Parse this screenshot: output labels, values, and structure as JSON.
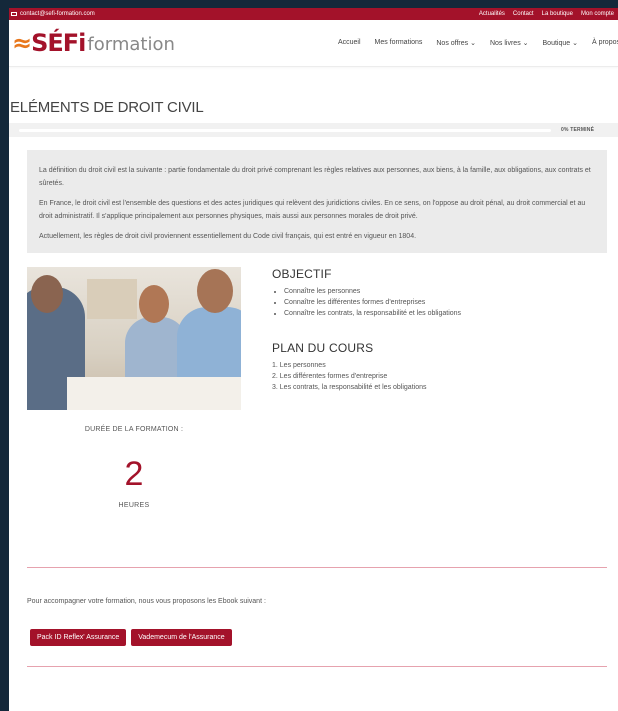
{
  "topbar": {
    "email": "contact@sefi-formation.com",
    "links": [
      "Actualités",
      "Contact",
      "La boutique",
      "Mon compte"
    ]
  },
  "brand": {
    "mark": "SÉFi",
    "word": "formation"
  },
  "nav": {
    "items": [
      {
        "label": "Accueil",
        "dropdown": false
      },
      {
        "label": "Mes formations",
        "dropdown": false
      },
      {
        "label": "Nos offres",
        "dropdown": true
      },
      {
        "label": "Nos livres",
        "dropdown": true
      },
      {
        "label": "Boutique",
        "dropdown": true
      },
      {
        "label": "À propos",
        "dropdown": false
      }
    ]
  },
  "course": {
    "title": "ELÉMENTS DE DROIT CIVIL",
    "progress_percent": 0,
    "progress_label": "0% TERMINÉ",
    "intro": [
      "La définition du droit civil est la suivante : partie fondamentale du droit privé comprenant les règles relatives aux personnes, aux biens, à la famille, aux obligations, aux contrats et sûretés.",
      "En France, le droit civil est l'ensemble des questions et des actes juridiques qui relèvent des juridictions civiles. En ce sens, on l'oppose au droit pénal, au droit commercial et au droit administratif. Il s'applique principalement aux personnes physiques, mais aussi aux personnes morales de droit privé.",
      "Actuellement, les règles de droit civil proviennent essentiellement du Code civil français, qui est entré en vigueur en 1804."
    ],
    "duration": {
      "label": "DURÉE DE LA FORMATION :",
      "value": "2",
      "unit": "HEURES"
    },
    "objectif": {
      "heading": "OBJECTIF",
      "items": [
        "Connaître les personnes",
        "Connaître les différentes formes d'entreprises",
        "Connaître les contrats, la responsabilité et les obligations"
      ]
    },
    "plan": {
      "heading": "PLAN DU COURS",
      "items": [
        "1. Les personnes",
        "2. Les différentes formes d'entreprise",
        "3. Les contrats, la responsabilité et les obligations"
      ]
    },
    "ebook_intro": "Pour accompagner votre formation, nous vous proposons les Ebook suivant :",
    "ebook_buttons": [
      "Pack ID Reflex' Assurance",
      "Vademecum de l'Assurance"
    ]
  },
  "colors": {
    "brand_red": "#a3122a",
    "brand_orange": "#e8771c",
    "frame": "#14283a"
  }
}
